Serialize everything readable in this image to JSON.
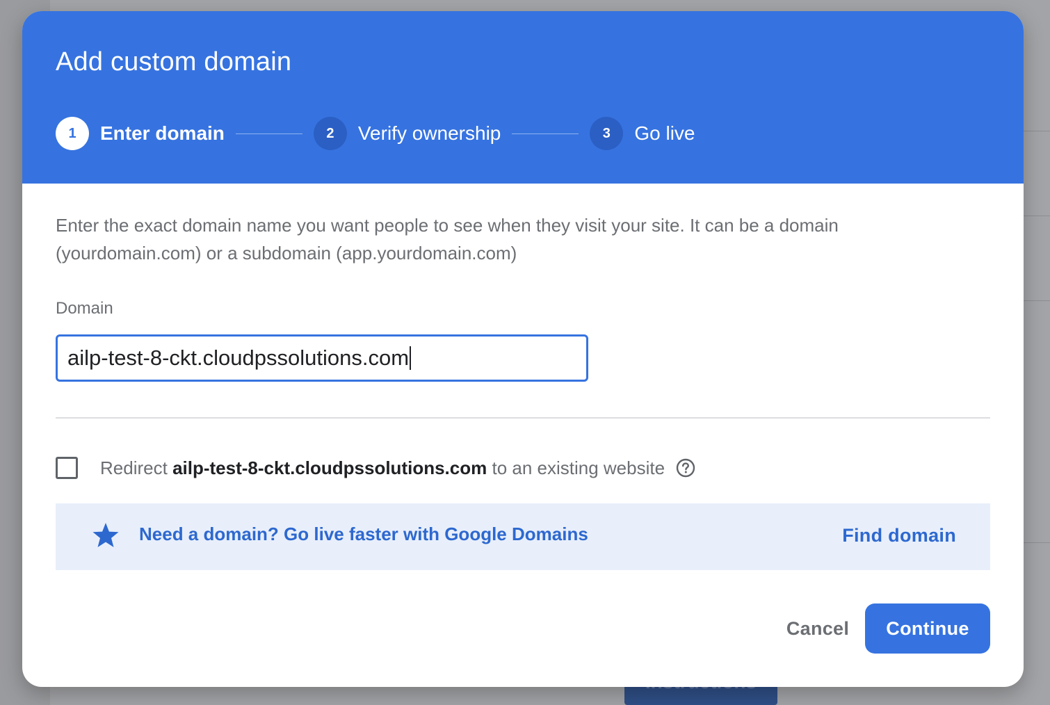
{
  "dialog": {
    "title": "Add custom domain",
    "steps": [
      {
        "number": "1",
        "label": "Enter domain",
        "state": "active"
      },
      {
        "number": "2",
        "label": "Verify ownership",
        "state": "inactive"
      },
      {
        "number": "3",
        "label": "Go live",
        "state": "inactive"
      }
    ],
    "description": "Enter the exact domain name you want people to see when they visit your site. It can be a domain (yourdomain.com) or a subdomain (app.yourdomain.com)",
    "domain_field": {
      "label": "Domain",
      "value": "ailp-test-8-ckt.cloudpssolutions.com"
    },
    "redirect": {
      "checked": false,
      "prefix": "Redirect",
      "domain": "ailp-test-8-ckt.cloudpssolutions.com",
      "suffix": "to an existing website",
      "help_icon": "help-circle-icon"
    },
    "banner": {
      "icon": "star-icon",
      "text": "Need a domain? Go live faster with Google Domains",
      "link_label": "Find domain"
    },
    "actions": {
      "cancel_label": "Cancel",
      "continue_label": "Continue"
    }
  },
  "background": {
    "button_label": "Instructions"
  },
  "colors": {
    "primary": "#3673e0",
    "primary_dark": "#2b5fc4",
    "banner_bg": "#e8effb",
    "link": "#2d68cf",
    "overlay": "#9a9b9e"
  }
}
